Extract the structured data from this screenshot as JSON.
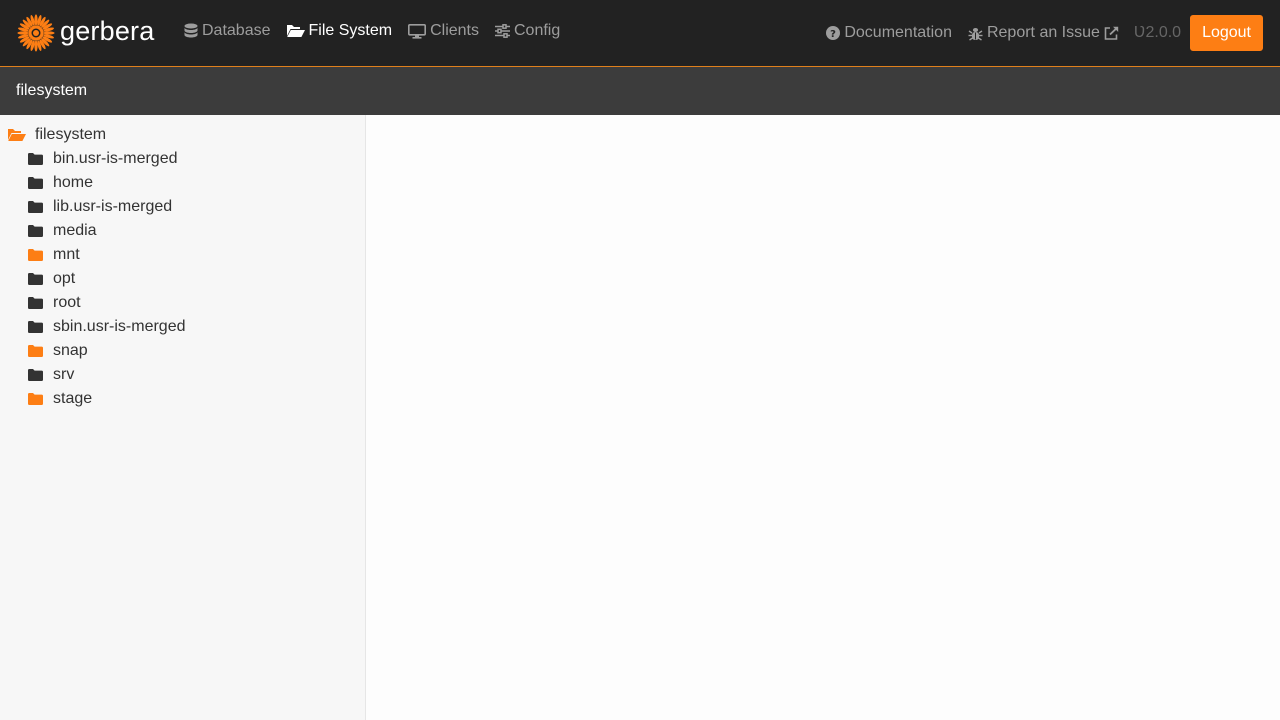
{
  "brand": {
    "name": "gerbera"
  },
  "nav": {
    "database": "Database",
    "filesystem": "File System",
    "clients": "Clients",
    "config": "Config",
    "documentation": "Documentation",
    "report_issue": "Report an Issue",
    "version": "Ʋ2.0.0",
    "logout": "Logout"
  },
  "breadcrumb": {
    "current": "filesystem"
  },
  "tree": {
    "root": "filesystem",
    "items": [
      {
        "label": "bin.usr-is-merged",
        "highlight": false
      },
      {
        "label": "home",
        "highlight": false
      },
      {
        "label": "lib.usr-is-merged",
        "highlight": false
      },
      {
        "label": "media",
        "highlight": false
      },
      {
        "label": "mnt",
        "highlight": true
      },
      {
        "label": "opt",
        "highlight": false
      },
      {
        "label": "root",
        "highlight": false
      },
      {
        "label": "sbin.usr-is-merged",
        "highlight": false
      },
      {
        "label": "snap",
        "highlight": true
      },
      {
        "label": "srv",
        "highlight": false
      },
      {
        "label": "stage",
        "highlight": true
      }
    ]
  },
  "colors": {
    "accent": "#fd7e14",
    "navbar": "#222222",
    "breadcrumb_bar": "#3c3c3c",
    "folder_default": "#333333",
    "folder_highlight": "#fd7e14"
  }
}
